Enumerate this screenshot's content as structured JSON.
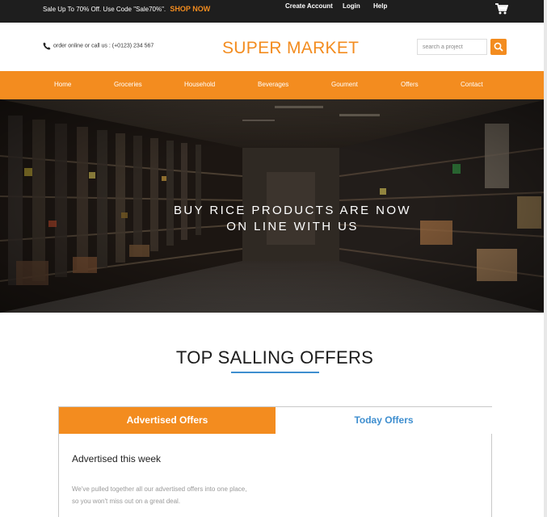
{
  "topbar": {
    "promo_text": "Sale Up To 70% Off. Use Code \"Sale70%\".",
    "promo_link": "SHOP NOW",
    "links": [
      "Create Account",
      "Login",
      "Help"
    ],
    "cart_icon": "cart-icon"
  },
  "header": {
    "phone_icon": "phone-icon",
    "phone_text": "order online or call us : (+0123) 234 567",
    "brand": "SUPER MARKET",
    "search_placeholder": "search a project",
    "search_icon": "search-icon"
  },
  "nav": {
    "items": [
      "Home",
      "Groceries",
      "Household",
      "Beverages",
      "Goument",
      "Offers",
      "Contact"
    ]
  },
  "hero": {
    "line1": "BUY RICE PRODUCTS ARE NOW",
    "line2": "ON LINE WITH US"
  },
  "section": {
    "title": "TOP SALLING OFFERS"
  },
  "tabs": {
    "items": [
      "Advertised Offers",
      "Today Offers"
    ],
    "active_index": 0,
    "heading": "Advertised this week",
    "desc_line1": "We've pulled together all our advertised offers into one place,",
    "desc_line2": "so you won't miss out on a great deal."
  },
  "colors": {
    "accent": "#f38c1f",
    "topbar_bg": "#1e1e1e",
    "link_blue": "#3e8ecf"
  }
}
